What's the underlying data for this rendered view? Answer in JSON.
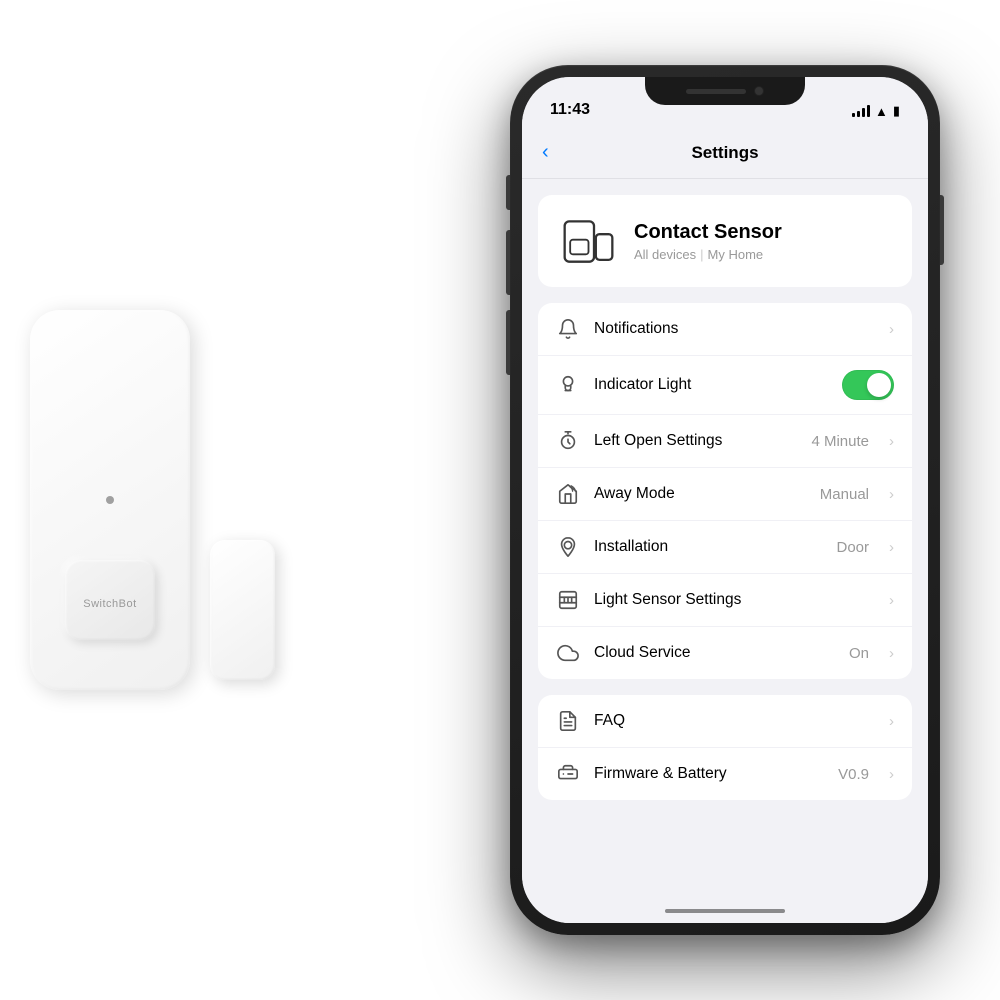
{
  "statusBar": {
    "time": "11:43",
    "locationIcon": "▶"
  },
  "navigation": {
    "backLabel": "‹",
    "title": "Settings"
  },
  "deviceHeader": {
    "name": "Contact Sensor",
    "path1": "All devices",
    "separator": "|",
    "path2": "My Home"
  },
  "settingsGroup1": {
    "rows": [
      {
        "id": "notifications",
        "label": "Notifications",
        "value": "",
        "hasChevron": true,
        "hasToggle": false,
        "iconType": "bell"
      },
      {
        "id": "indicator-light",
        "label": "Indicator Light",
        "value": "",
        "hasChevron": false,
        "hasToggle": true,
        "toggleOn": true,
        "iconType": "bulb"
      },
      {
        "id": "left-open-settings",
        "label": "Left Open Settings",
        "value": "4 Minute",
        "hasChevron": true,
        "hasToggle": false,
        "iconType": "timer"
      },
      {
        "id": "away-mode",
        "label": "Away Mode",
        "value": "Manual",
        "hasChevron": true,
        "hasToggle": false,
        "iconType": "home"
      },
      {
        "id": "installation",
        "label": "Installation",
        "value": "Door",
        "hasChevron": true,
        "hasToggle": false,
        "iconType": "pin"
      },
      {
        "id": "light-sensor-settings",
        "label": "Light Sensor Settings",
        "value": "",
        "hasChevron": true,
        "hasToggle": false,
        "iconType": "chart"
      },
      {
        "id": "cloud-service",
        "label": "Cloud Service",
        "value": "On",
        "hasChevron": true,
        "hasToggle": false,
        "iconType": "cloud"
      }
    ]
  },
  "settingsGroup2": {
    "rows": [
      {
        "id": "faq",
        "label": "FAQ",
        "value": "",
        "hasChevron": true,
        "hasToggle": false,
        "iconType": "faq"
      },
      {
        "id": "firmware-battery",
        "label": "Firmware & Battery",
        "value": "V0.9",
        "hasChevron": true,
        "hasToggle": false,
        "iconType": "firmware"
      }
    ]
  },
  "deviceBrand": "SwitchBot"
}
